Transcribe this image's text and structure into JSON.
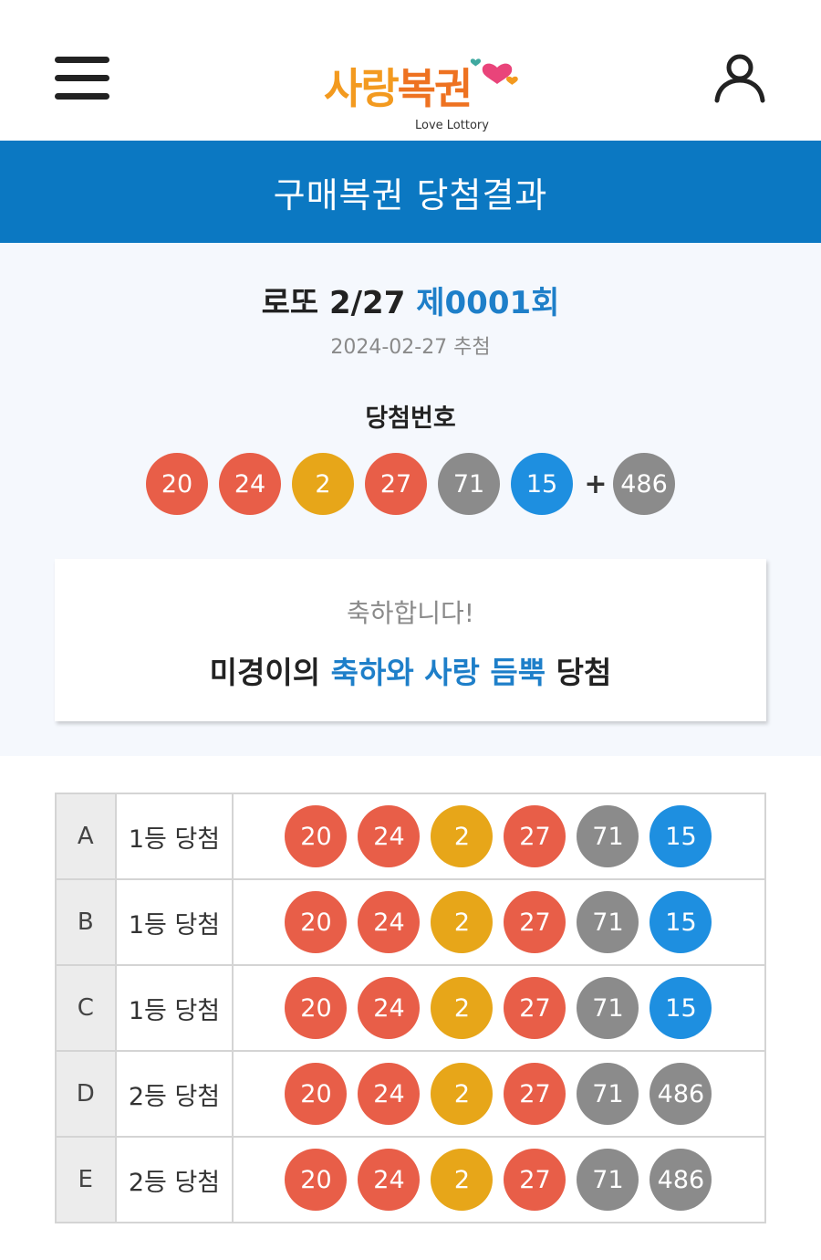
{
  "header": {
    "logo_text_1": "사랑",
    "logo_text_2": "복권",
    "logo_sub": "Love Lottory"
  },
  "title_bar": {
    "title": "구매복권 당첨결과"
  },
  "draw": {
    "game": "로또 2/27",
    "round": "제0001회",
    "date": "2024-02-27 추첨",
    "win_label": "당첨번호",
    "numbers": [
      {
        "value": "20",
        "color": "#e85e48"
      },
      {
        "value": "24",
        "color": "#e85e48"
      },
      {
        "value": "2",
        "color": "#e7a619"
      },
      {
        "value": "27",
        "color": "#e85e48"
      },
      {
        "value": "71",
        "color": "#8b8b8b"
      },
      {
        "value": "15",
        "color": "#1e8fe0"
      }
    ],
    "plus": "+",
    "bonus": {
      "value": "486",
      "color": "#8b8b8b"
    }
  },
  "congrats": {
    "subtitle": "축하합니다!",
    "msg_1": "미경이의",
    "msg_highlight": "축하와 사랑 듬뿍",
    "msg_2": "당첨"
  },
  "results": [
    {
      "id": "A",
      "rank": "1등 당첨",
      "balls": [
        "20",
        "24",
        "2",
        "27",
        "71",
        "15"
      ]
    },
    {
      "id": "B",
      "rank": "1등 당첨",
      "balls": [
        "20",
        "24",
        "2",
        "27",
        "71",
        "15"
      ]
    },
    {
      "id": "C",
      "rank": "1등 당첨",
      "balls": [
        "20",
        "24",
        "2",
        "27",
        "71",
        "15"
      ]
    },
    {
      "id": "D",
      "rank": "2등 당첨",
      "balls": [
        "20",
        "24",
        "2",
        "27",
        "71",
        "486"
      ]
    },
    {
      "id": "E",
      "rank": "2등 당첨",
      "balls": [
        "20",
        "24",
        "2",
        "27",
        "71",
        "486"
      ]
    }
  ],
  "colors": {
    "brand_blue": "#0b78c2",
    "highlight_blue": "#1e7fc9",
    "ball_red": "#e85e48",
    "ball_yellow": "#e7a619",
    "ball_gray": "#8b8b8b",
    "ball_blue": "#1e8fe0",
    "logo_orange": "#ee7221"
  }
}
